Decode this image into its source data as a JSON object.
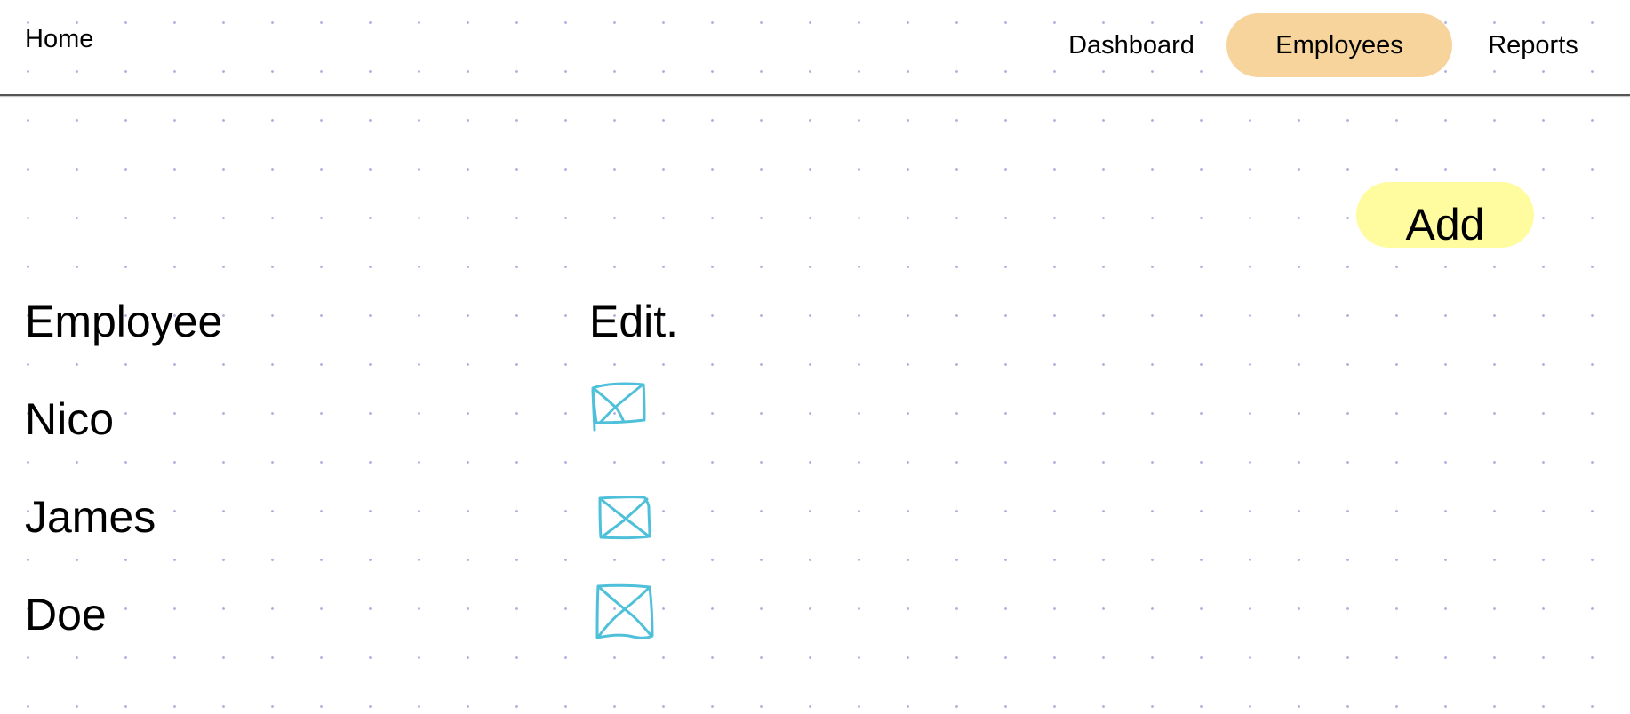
{
  "nav": {
    "home_label": "Home",
    "items": [
      {
        "label": "Dashboard",
        "active": false
      },
      {
        "label": "Employees",
        "active": true
      },
      {
        "label": "Reports",
        "active": false
      }
    ]
  },
  "actions": {
    "add_label": "Add"
  },
  "table": {
    "headers": {
      "employee": "Employee",
      "edit": "Edit."
    },
    "rows": [
      {
        "name": "Nico",
        "edit_icon": "edit-image-placeholder-icon"
      },
      {
        "name": "James",
        "edit_icon": "edit-image-placeholder-icon"
      },
      {
        "name": "Doe",
        "edit_icon": "edit-image-placeholder-icon"
      }
    ]
  },
  "colors": {
    "active_tab": "#f6d49c",
    "add_button": "#fefc9e",
    "edit_icon_stroke": "#4fc0da",
    "dot_grid": "#b4b4e0"
  }
}
